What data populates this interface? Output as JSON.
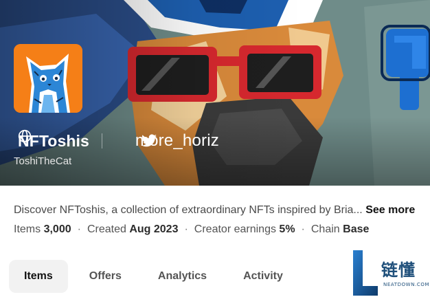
{
  "collection": {
    "name": "NFToshis",
    "creator": "ToshiTheCat",
    "more_label": "more_horiz",
    "description": "Discover NFToshis, a collection of extraordinary NFTs inspired by Bria...",
    "see_more_label": "See more"
  },
  "stats": [
    {
      "label": "Items",
      "value": "3,000"
    },
    {
      "label": "Created",
      "value": "Aug 2023"
    },
    {
      "label": "Creator earnings",
      "value": "5%"
    },
    {
      "label": "Chain",
      "value": "Base"
    }
  ],
  "tabs": [
    {
      "label": "Items",
      "active": true
    },
    {
      "label": "Offers",
      "active": false
    },
    {
      "label": "Analytics",
      "active": false
    },
    {
      "label": "Activity",
      "active": false
    }
  ],
  "watermark": {
    "text": "链懂",
    "subtext": "NEATDOWN.COM"
  },
  "icons": [
    "globe-icon",
    "twitter-icon"
  ],
  "colors": {
    "avatar_bg": "#f57f17",
    "active_tab_bg": "#f2f2f2",
    "text_primary": "#121212"
  }
}
